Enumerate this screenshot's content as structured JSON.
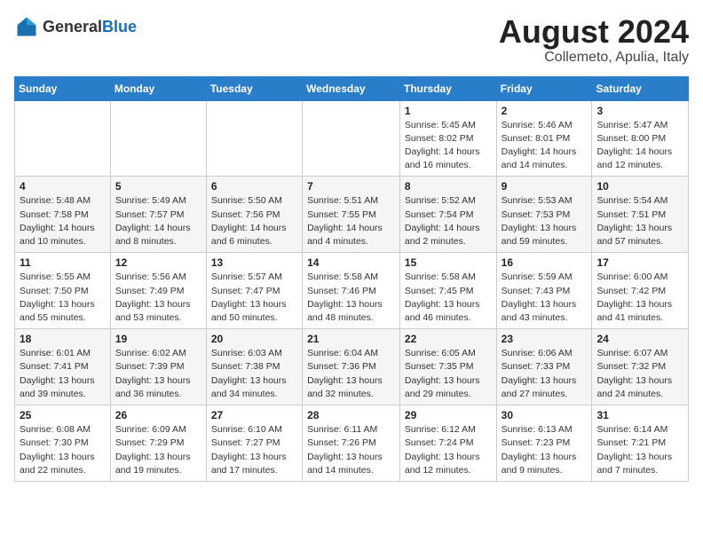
{
  "header": {
    "logo_general": "General",
    "logo_blue": "Blue",
    "calendar_title": "August 2024",
    "calendar_subtitle": "Collemeto, Apulia, Italy"
  },
  "days_of_week": [
    "Sunday",
    "Monday",
    "Tuesday",
    "Wednesday",
    "Thursday",
    "Friday",
    "Saturday"
  ],
  "weeks": [
    [
      {
        "day": "",
        "info": ""
      },
      {
        "day": "",
        "info": ""
      },
      {
        "day": "",
        "info": ""
      },
      {
        "day": "",
        "info": ""
      },
      {
        "day": "1",
        "info": "Sunrise: 5:45 AM\nSunset: 8:02 PM\nDaylight: 14 hours\nand 16 minutes."
      },
      {
        "day": "2",
        "info": "Sunrise: 5:46 AM\nSunset: 8:01 PM\nDaylight: 14 hours\nand 14 minutes."
      },
      {
        "day": "3",
        "info": "Sunrise: 5:47 AM\nSunset: 8:00 PM\nDaylight: 14 hours\nand 12 minutes."
      }
    ],
    [
      {
        "day": "4",
        "info": "Sunrise: 5:48 AM\nSunset: 7:58 PM\nDaylight: 14 hours\nand 10 minutes."
      },
      {
        "day": "5",
        "info": "Sunrise: 5:49 AM\nSunset: 7:57 PM\nDaylight: 14 hours\nand 8 minutes."
      },
      {
        "day": "6",
        "info": "Sunrise: 5:50 AM\nSunset: 7:56 PM\nDaylight: 14 hours\nand 6 minutes."
      },
      {
        "day": "7",
        "info": "Sunrise: 5:51 AM\nSunset: 7:55 PM\nDaylight: 14 hours\nand 4 minutes."
      },
      {
        "day": "8",
        "info": "Sunrise: 5:52 AM\nSunset: 7:54 PM\nDaylight: 14 hours\nand 2 minutes."
      },
      {
        "day": "9",
        "info": "Sunrise: 5:53 AM\nSunset: 7:53 PM\nDaylight: 13 hours\nand 59 minutes."
      },
      {
        "day": "10",
        "info": "Sunrise: 5:54 AM\nSunset: 7:51 PM\nDaylight: 13 hours\nand 57 minutes."
      }
    ],
    [
      {
        "day": "11",
        "info": "Sunrise: 5:55 AM\nSunset: 7:50 PM\nDaylight: 13 hours\nand 55 minutes."
      },
      {
        "day": "12",
        "info": "Sunrise: 5:56 AM\nSunset: 7:49 PM\nDaylight: 13 hours\nand 53 minutes."
      },
      {
        "day": "13",
        "info": "Sunrise: 5:57 AM\nSunset: 7:47 PM\nDaylight: 13 hours\nand 50 minutes."
      },
      {
        "day": "14",
        "info": "Sunrise: 5:58 AM\nSunset: 7:46 PM\nDaylight: 13 hours\nand 48 minutes."
      },
      {
        "day": "15",
        "info": "Sunrise: 5:58 AM\nSunset: 7:45 PM\nDaylight: 13 hours\nand 46 minutes."
      },
      {
        "day": "16",
        "info": "Sunrise: 5:59 AM\nSunset: 7:43 PM\nDaylight: 13 hours\nand 43 minutes."
      },
      {
        "day": "17",
        "info": "Sunrise: 6:00 AM\nSunset: 7:42 PM\nDaylight: 13 hours\nand 41 minutes."
      }
    ],
    [
      {
        "day": "18",
        "info": "Sunrise: 6:01 AM\nSunset: 7:41 PM\nDaylight: 13 hours\nand 39 minutes."
      },
      {
        "day": "19",
        "info": "Sunrise: 6:02 AM\nSunset: 7:39 PM\nDaylight: 13 hours\nand 36 minutes."
      },
      {
        "day": "20",
        "info": "Sunrise: 6:03 AM\nSunset: 7:38 PM\nDaylight: 13 hours\nand 34 minutes."
      },
      {
        "day": "21",
        "info": "Sunrise: 6:04 AM\nSunset: 7:36 PM\nDaylight: 13 hours\nand 32 minutes."
      },
      {
        "day": "22",
        "info": "Sunrise: 6:05 AM\nSunset: 7:35 PM\nDaylight: 13 hours\nand 29 minutes."
      },
      {
        "day": "23",
        "info": "Sunrise: 6:06 AM\nSunset: 7:33 PM\nDaylight: 13 hours\nand 27 minutes."
      },
      {
        "day": "24",
        "info": "Sunrise: 6:07 AM\nSunset: 7:32 PM\nDaylight: 13 hours\nand 24 minutes."
      }
    ],
    [
      {
        "day": "25",
        "info": "Sunrise: 6:08 AM\nSunset: 7:30 PM\nDaylight: 13 hours\nand 22 minutes."
      },
      {
        "day": "26",
        "info": "Sunrise: 6:09 AM\nSunset: 7:29 PM\nDaylight: 13 hours\nand 19 minutes."
      },
      {
        "day": "27",
        "info": "Sunrise: 6:10 AM\nSunset: 7:27 PM\nDaylight: 13 hours\nand 17 minutes."
      },
      {
        "day": "28",
        "info": "Sunrise: 6:11 AM\nSunset: 7:26 PM\nDaylight: 13 hours\nand 14 minutes."
      },
      {
        "day": "29",
        "info": "Sunrise: 6:12 AM\nSunset: 7:24 PM\nDaylight: 13 hours\nand 12 minutes."
      },
      {
        "day": "30",
        "info": "Sunrise: 6:13 AM\nSunset: 7:23 PM\nDaylight: 13 hours\nand 9 minutes."
      },
      {
        "day": "31",
        "info": "Sunrise: 6:14 AM\nSunset: 7:21 PM\nDaylight: 13 hours\nand 7 minutes."
      }
    ]
  ]
}
